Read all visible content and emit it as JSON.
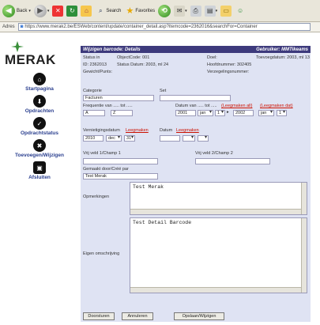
{
  "browser": {
    "back_label": "Back",
    "search_label": "Search",
    "favorites_label": "Favorites",
    "address_label": "Adres",
    "url": "https://www.merak2.be/ESWeb/content/update/container_detail.asp?itemcode=2362016&searchFor=Container"
  },
  "sidebar": {
    "logo": "MERAK",
    "items": [
      {
        "label": "Startpagina",
        "icon": "home-icon"
      },
      {
        "label": "Opdrachten",
        "icon": "download-icon"
      },
      {
        "label": "Opdrachtstatus",
        "icon": "check-icon"
      },
      {
        "label": "Toevoegen/Wijzigen",
        "icon": "tools-icon"
      },
      {
        "label": "Afsluiten",
        "icon": "exit-icon"
      }
    ]
  },
  "header": {
    "title": "Wijzigen barcode: Details",
    "user": "Gebruiker: MMTikeams"
  },
  "info": {
    "status": "Status in",
    "object_code": "ObjectCode: 001",
    "doel": "Doel:",
    "toevoegdatum": "Toevoegdatum: 2003, ml 13",
    "id": "ID: 2362013",
    "status_datum": "Status Datum: 2003, ml 24",
    "hoofdnummer": "Hoofdnummer: 302405",
    "gewicht": "Gewicht/Punts:",
    "verzegeling": "Verzegelingsnummer:"
  },
  "form": {
    "categorie_label": "Categorie",
    "categorie_value": "Facturen",
    "set_label": "Set",
    "frequentie_label": "Frequentie van ..... tot .....",
    "freq_from": "A",
    "freq_to": "Z",
    "datum_label": "Datum van ..... tot .....",
    "leegmaken_all": "(Leegmaken all)",
    "leegmaken_dat": "(Leegmaken dat)",
    "datum_from_year": "2001",
    "datum_from_month": "jan",
    "datum_from_day": "1",
    "datum_to_year": "2002",
    "datum_to_month": "jan",
    "datum_to_day": "1",
    "vernietiging_label": "Vernietigingsdatum",
    "leegmaken": "Leegmaken",
    "vern_year": "2010",
    "vern_month": "dec",
    "vern_day": "31",
    "datum2_label": "Datum",
    "vrij1_label": "Vrij veld 1/Champ 1",
    "vrij2_label": "Vrij veld 2/Champ 2",
    "gemaakt_label": "Gemaakt door/Créé par",
    "gemaakt_value": "Test Merak",
    "opmerkingen_label": "Opmerkingen",
    "opmerkingen_value": "Test Merak",
    "omschrijving_label": "Eigen omschrijving",
    "omschrijving_value": "Test Detail Barcode"
  },
  "buttons": {
    "doorsturen": "Doorsturen",
    "annuleren": "Annuleren",
    "opslaan": "Opslaan/Wijzigen"
  }
}
